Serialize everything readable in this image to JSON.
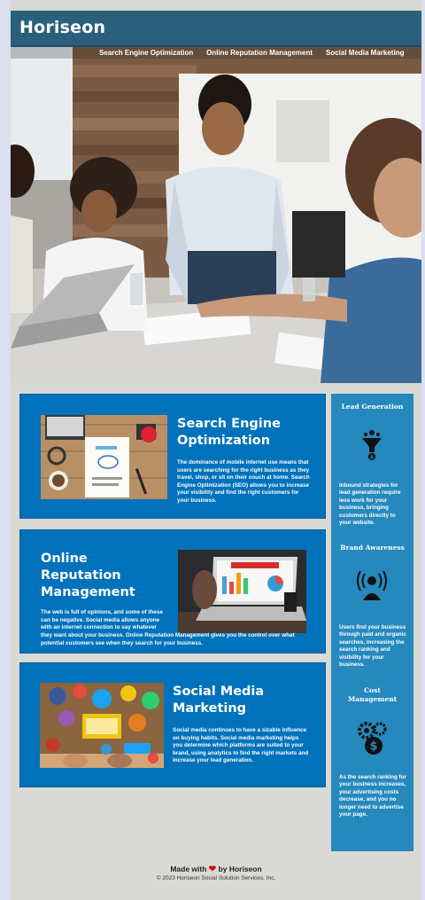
{
  "header": {
    "logo": "Horiseon"
  },
  "nav": [
    {
      "label": "Search Engine Optimization"
    },
    {
      "label": "Online Reputation Management"
    },
    {
      "label": "Social Media Marketing"
    }
  ],
  "sections": [
    {
      "title_line1": "Search Engine",
      "title_line2": "Optimization",
      "text": "The dominance of mobile internet use means that users are searching for the right business as they travel, shop, or sit on their couch at home. Search Engine Optimization (SEO) allows you to increase your visibility and find the right customers for your business."
    },
    {
      "title_line1": "Online",
      "title_line2": "Reputation",
      "title_line3": "Management",
      "text_a": "The web is full of opinions, and some of these can be negative. Social media allows anyone with an internet connection to say whatever",
      "text_b": "they want about your business. Online Reputation Management gives you the control over what potential customers see when they search for your business."
    },
    {
      "title_line1": "Social Media",
      "title_line2": "Marketing",
      "text": "Social media continues to have a sizable influence on buying habits. Social media marketing helps you determine which platforms are suited to your brand, using analytics to find the right markets and increase your lead generation."
    }
  ],
  "benefits": [
    {
      "title": "Lead Generation",
      "icon": "lead-funnel-icon",
      "text": "Inbound strategies for lead generation require less work for your business, bringing customers directly to your website."
    },
    {
      "title": "Brand Awareness",
      "icon": "broadcast-person-icon",
      "text": "Users find your business through paid and organic searches, increasing the search ranking and visibility for your business."
    },
    {
      "title_line1": "Cost",
      "title_line2": "Management",
      "icon": "gears-dollar-icon",
      "text": "As the search ranking for your business increases, your advertising costs decrease, and you no longer need to advertise your page."
    }
  ],
  "footer": {
    "made_prefix": "Made with",
    "made_suffix": "by Horiseon",
    "heart": "❤",
    "copyright": "© 2023 Horiseon Social Solution Services, Inc."
  },
  "colors": {
    "header": "#2a607c",
    "card": "#0072bb",
    "aside": "#2589bd",
    "page": "#d9d9d5"
  }
}
